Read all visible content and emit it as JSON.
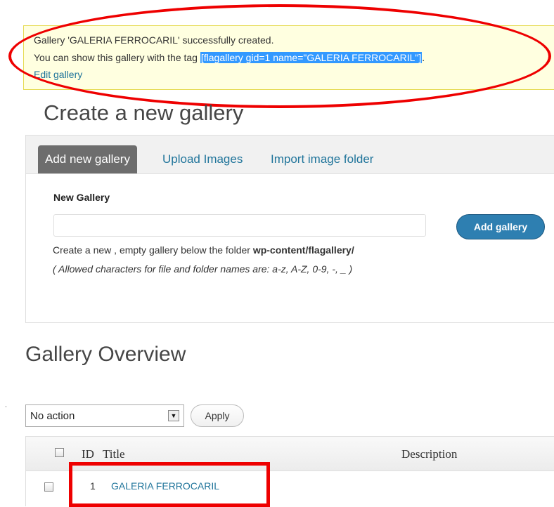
{
  "notice": {
    "line1": "Gallery 'GALERIA FERROCARIL' successfully created.",
    "line2_prefix": "You can show this gallery with the tag ",
    "line2_tag": "[flagallery gid=1 name=\"GALERIA FERROCARIL\"]",
    "line2_suffix": ".",
    "edit_link": "Edit gallery"
  },
  "page_title": "Create a new gallery",
  "tabs": [
    {
      "label": "Add new gallery",
      "active": true
    },
    {
      "label": "Upload Images",
      "active": false
    },
    {
      "label": "Import image folder",
      "active": false
    }
  ],
  "new_gallery": {
    "label": "New Gallery",
    "input_value": "",
    "button_label": "Add gallery",
    "help_prefix": "Create a new , empty gallery below the folder ",
    "help_folder": "wp-content/flagallery/",
    "help_allowed": "( Allowed characters for file and folder names are: a-z, A-Z, 0-9, -, _ )"
  },
  "overview": {
    "title": "Gallery Overview",
    "bulk_action": "No action",
    "apply_label": "Apply",
    "columns": {
      "id": "ID",
      "title": "Title",
      "description": "Description"
    },
    "rows": [
      {
        "id": "1",
        "title": "GALERIA FERROCARIL"
      }
    ]
  },
  "colors": {
    "annotation_red": "#ee0000",
    "link_blue": "#21759b",
    "notice_bg": "#ffffe0",
    "button_blue": "#2e7fb1"
  }
}
